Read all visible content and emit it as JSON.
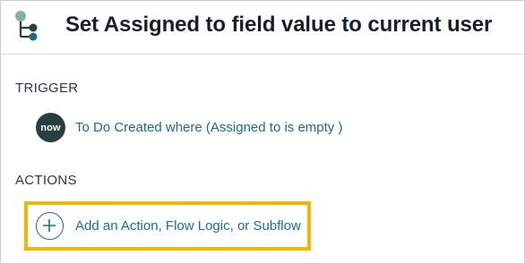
{
  "header": {
    "title": "Set Assigned to field value to current user",
    "icon": "flow-diagram-icon"
  },
  "trigger": {
    "section_label": "TRIGGER",
    "badge_text": "now",
    "description": "To Do Created where (Assigned to is empty )"
  },
  "actions": {
    "section_label": "ACTIONS",
    "add_label": "Add an Action, Flow Logic, or Subflow",
    "add_icon": "plus-circle-icon"
  },
  "colors": {
    "link": "#1b6e86",
    "highlight": "#f2b705",
    "badge_bg": "#293e40",
    "icon_green": "#81b5a1",
    "icon_dark": "#293e40",
    "icon_teal": "#1b6e86"
  }
}
